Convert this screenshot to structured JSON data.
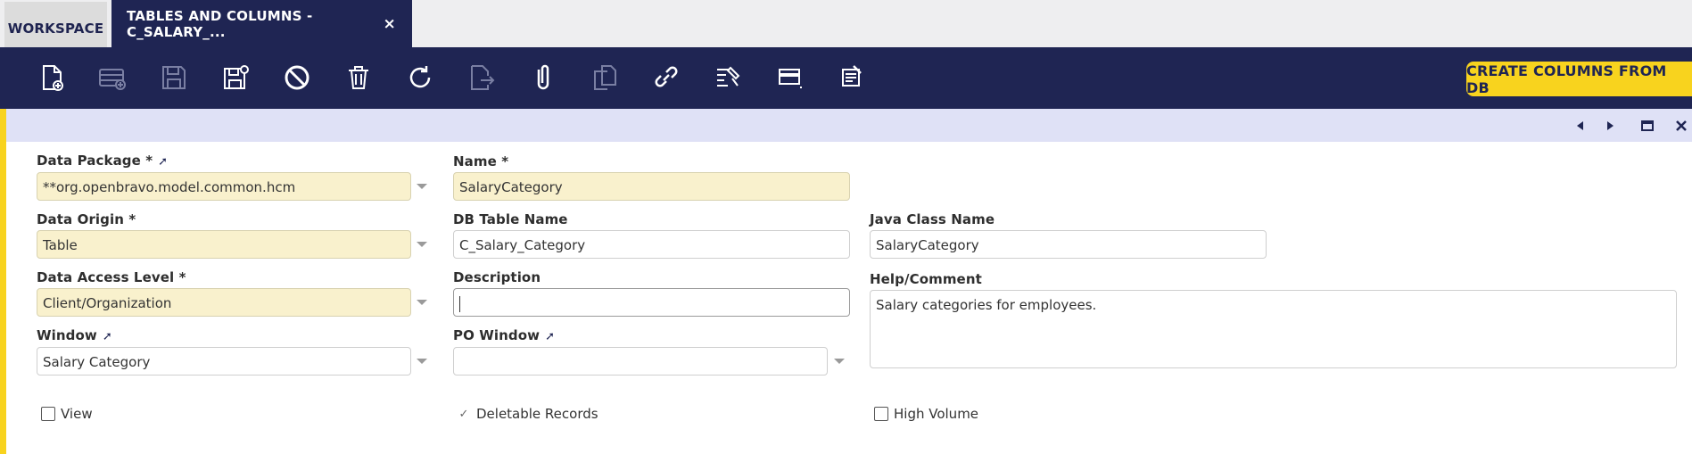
{
  "tabs": {
    "workspace": "WORKSPACE",
    "active": "TABLES AND COLUMNS - C_SALARY_...",
    "close": "×"
  },
  "toolbar": {
    "icons": [
      "new-document-icon",
      "new-row-icon",
      "save-icon",
      "save-close-icon",
      "cancel-icon",
      "delete-icon",
      "refresh-icon",
      "export-icon",
      "attach-icon",
      "copy-icon",
      "link-icon",
      "tools-icon",
      "grid-toggle-icon",
      "notes-icon"
    ],
    "create_button": "CREATE COLUMNS FROM DB"
  },
  "form": {
    "data_package": {
      "label": "Data Package *",
      "value": "**org.openbravo.model.common.hcm"
    },
    "name": {
      "label": "Name *",
      "value": "SalaryCategory"
    },
    "data_origin": {
      "label": "Data Origin *",
      "value": "Table"
    },
    "db_table_name": {
      "label": "DB Table Name",
      "value": "C_Salary_Category"
    },
    "java_class_name": {
      "label": "Java Class Name",
      "value": "SalaryCategory"
    },
    "data_access_level": {
      "label": "Data Access Level *",
      "value": "Client/Organization"
    },
    "description": {
      "label": "Description",
      "value": ""
    },
    "help_comment": {
      "label": "Help/Comment",
      "value": "Salary categories for employees."
    },
    "window": {
      "label": "Window",
      "value": "Salary Category"
    },
    "po_window": {
      "label": "PO Window",
      "value": ""
    },
    "view": {
      "label": "View",
      "checked": false
    },
    "deletable_records": {
      "label": "Deletable Records",
      "checked": true
    },
    "high_volume": {
      "label": "High Volume",
      "checked": false
    }
  },
  "colors": {
    "navy": "#1f2553",
    "accent_yellow": "#f8d31e",
    "required_bg": "#f9f1cd",
    "status_bar": "#dfe1f6"
  }
}
